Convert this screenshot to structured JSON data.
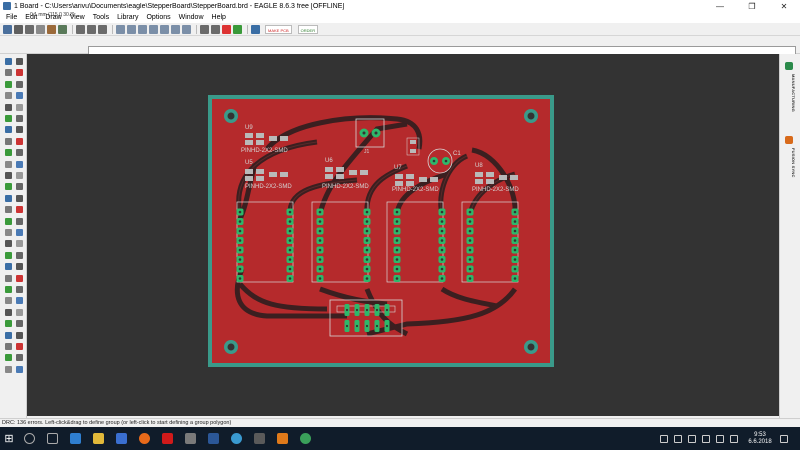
{
  "window": {
    "title": "1 Board - C:\\Users\\arivu\\Documents\\eagle\\StepperBoard\\StepperBoard.brd - EAGLE 8.6.3 free [OFFLINE]",
    "minimize": "—",
    "maximize": "❐",
    "close": "✕"
  },
  "menu": {
    "items": [
      "File",
      "Edit",
      "Draw",
      "View",
      "Tools",
      "Library",
      "Options",
      "Window",
      "Help"
    ]
  },
  "toolbar": {
    "badge1": "MAKE PCB",
    "badge2": "ORDER"
  },
  "command": {
    "coordinate": "0.1 mm (115.0 30.8)",
    "input_value": "",
    "input_placeholder": ""
  },
  "board": {
    "components": [
      {
        "ref": "U5",
        "value": "PINHD-2X2-SMD"
      },
      {
        "ref": "U6",
        "value": "PINHD-2X2-SMD"
      },
      {
        "ref": "U7",
        "value": "PINHD-2X2-SMD"
      },
      {
        "ref": "U8",
        "value": "PINHD-2X2-SMD"
      },
      {
        "ref": "U9",
        "value": "PINHD-2X2-SMD"
      }
    ],
    "c1": "C1",
    "j1": "J1",
    "colors": {
      "board_fill": "#b52a2c",
      "board_outline": "#3a9a8a",
      "background": "#333333",
      "pad": "#2db86a"
    }
  },
  "right_panel": {
    "tab1": "MANUFACTURING",
    "tab2": "FUSION SYNC"
  },
  "status": {
    "text": "DRC: 136 errors. Left-click&drag to define group (or left-click to start defining a group polygon)"
  },
  "taskbar": {
    "start": "⊞",
    "time": "9:53",
    "date": "6.6.2018"
  }
}
